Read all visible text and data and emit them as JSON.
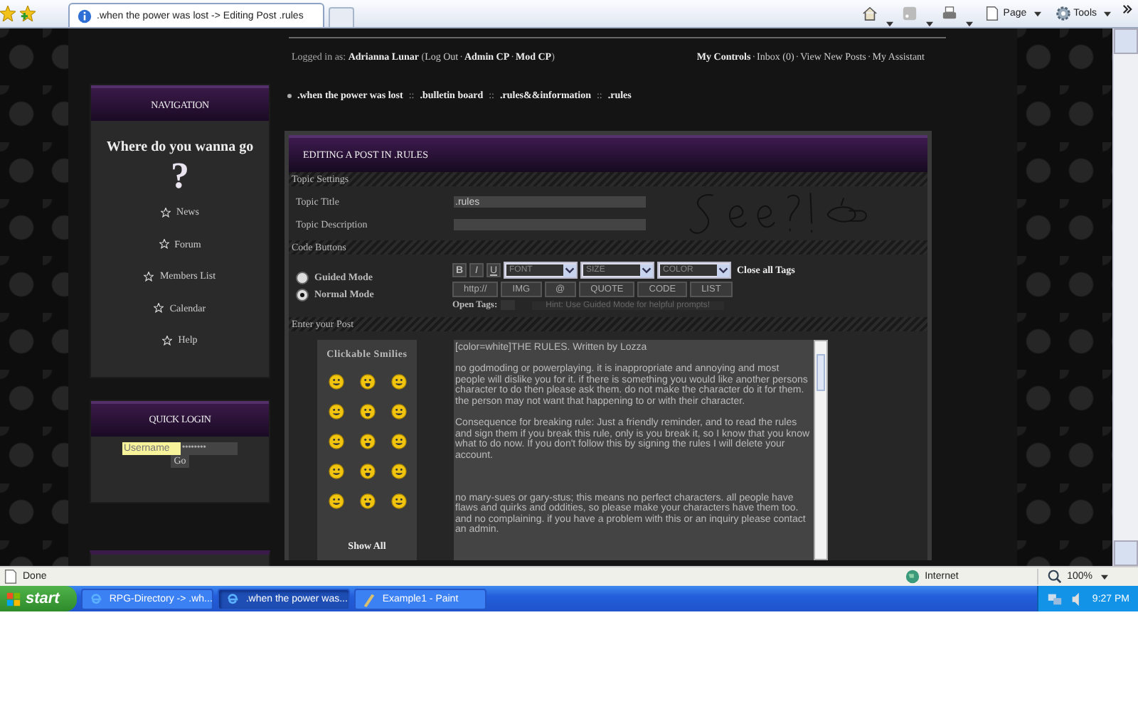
{
  "browser": {
    "tab_title": ".when the power was lost -> Editing Post .rules",
    "commands": [
      "Page",
      "Tools"
    ]
  },
  "user_bar": {
    "prefix": "Logged in as: **Adrianna Lunar** (",
    "links": [
      "Log Out",
      "Admin CP",
      "Mod CP"
    ],
    "close": ")",
    "separator": "·",
    "right_links": [
      "My Controls",
      "Inbox (0)",
      "View New Posts",
      "My Assistant"
    ]
  },
  "breadcrumb": {
    "separator": "::",
    "items": [
      ".when the power was lost",
      ".bulletin board",
      ".rules&&information",
      ".rules"
    ]
  },
  "navigation": {
    "title": "NAVIGATION",
    "heading": "Where do you wanna go",
    "mark": "?",
    "items": [
      "News",
      "Forum",
      "Members List",
      "Calendar",
      "Help"
    ]
  },
  "quick_login": {
    "title": "QUICK LOGIN",
    "username_placeholder": "Username",
    "password_value": "••••••••",
    "button": "Go"
  },
  "editor": {
    "title": "EDITING A POST IN .RULES",
    "topic_settings": {
      "label": "Topic Settings",
      "fields": [
        {
          "label": "Topic Title",
          "value": ".rules"
        },
        {
          "label": "Topic Description"
        }
      ]
    },
    "code_buttons": {
      "label": "Code Buttons",
      "modes": [
        {
          "label": "Guided Mode",
          "selected": false
        },
        {
          "label": "Normal Mode",
          "selected": true
        }
      ],
      "format_buttons": [
        "B",
        "I",
        "U"
      ],
      "selects": [
        "FONT",
        "SIZE",
        "COLOR"
      ],
      "close_all": "Close all Tags",
      "tag_buttons": [
        "http://",
        "IMG",
        "@",
        "QUOTE",
        "CODE",
        "LIST"
      ],
      "open_tags_label": "Open Tags:",
      "hint": "Hint: Use Guided Mode for helpful prompts!"
    },
    "enter_post": {
      "label": "Enter your Post",
      "smilies_title": "Clickable Smilies",
      "show_all": "Show All",
      "post_text": [
        "[color=white]THE RULES. Written by Lozza",
        "no godmoding or powerplaying. it is inappropriate and annoying and most people will dislike you for it. if there is something you would like another persons character to do then please ask them. do not make the character do it for them. the person may not want that happening to or with their character.",
        "Consequence for breaking rule: Just a friendly reminder, and to read the rules and sign them if you break this rule, only is you break it, so I know that you know what to do now. If you don't follow this by signing the rules I will delete your account.",
        "no mary-sues or gary-stus; this means no perfect characters. all people have flaws and quirks and oddities, so please make your characters have them too. and no complaining. if you have a problem with this or an inquiry please contact an  admin."
      ]
    }
  },
  "status_bar": {
    "text": "Done",
    "zone": "Internet",
    "zoom": "100%"
  },
  "taskbar": {
    "start": "start",
    "tasks": [
      {
        "label": "RPG-Directory -> .wh...",
        "selected": false
      },
      {
        "label": ".when the power was...",
        "selected": true
      },
      {
        "label": "Example1 - Paint",
        "selected": false
      }
    ],
    "clock": "9:27 PM"
  }
}
